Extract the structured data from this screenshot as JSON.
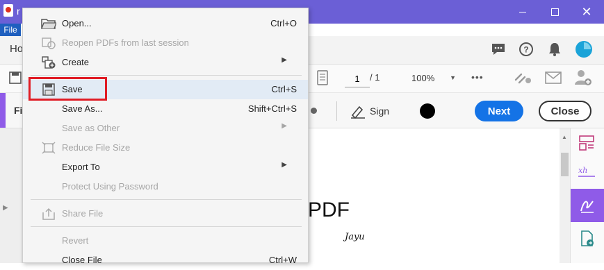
{
  "titlebar": {
    "title_char": "r",
    "window_controls": [
      "minimize-icon",
      "maximize-icon",
      "close-icon"
    ]
  },
  "menubar": {
    "file_label": "File"
  },
  "tabs": {
    "home_partial": "Ho"
  },
  "toolbar": {
    "page_current": "1",
    "page_total": "/ 1",
    "zoom": "100%",
    "more": "•••"
  },
  "signbar": {
    "fill_label_partial": "Fi",
    "sign_label": "Sign",
    "next_label": "Next",
    "close_label": "Close"
  },
  "document": {
    "visible_text": "PDF",
    "signature": "Jayu"
  },
  "file_menu": {
    "items": [
      {
        "label": "Open...",
        "shortcut": "Ctrl+O",
        "icon": "folder-open-icon",
        "enabled": true
      },
      {
        "label": "Reopen PDFs from last session",
        "shortcut": "",
        "icon": "reopen-icon",
        "enabled": false
      },
      {
        "label": "Create",
        "shortcut": "",
        "icon": "create-icon",
        "enabled": true,
        "submenu": true
      },
      {
        "label": "Save",
        "shortcut": "Ctrl+S",
        "icon": "save-icon",
        "enabled": true,
        "highlighted": true
      },
      {
        "label": "Save As...",
        "shortcut": "Shift+Ctrl+S",
        "icon": "",
        "enabled": true
      },
      {
        "label": "Save as Other",
        "shortcut": "",
        "icon": "",
        "enabled": false,
        "submenu": true
      },
      {
        "label": "Reduce File Size",
        "shortcut": "",
        "icon": "reduce-size-icon",
        "enabled": false
      },
      {
        "label": "Export To",
        "shortcut": "",
        "icon": "",
        "enabled": true,
        "submenu": true
      },
      {
        "label": "Protect Using Password",
        "shortcut": "",
        "icon": "",
        "enabled": false
      },
      {
        "label": "Share File",
        "shortcut": "",
        "icon": "share-icon",
        "enabled": false
      },
      {
        "label": "Revert",
        "shortcut": "",
        "icon": "",
        "enabled": false
      },
      {
        "label": "Close File",
        "shortcut": "Ctrl+W",
        "icon": "",
        "enabled": true
      }
    ]
  },
  "colors": {
    "titlebar": "#6b5fd6",
    "accent_purple": "#8f5be8",
    "next_button": "#1473e6",
    "highlight_box": "#e01b24",
    "menu_highlight": "#e2ebf5"
  }
}
